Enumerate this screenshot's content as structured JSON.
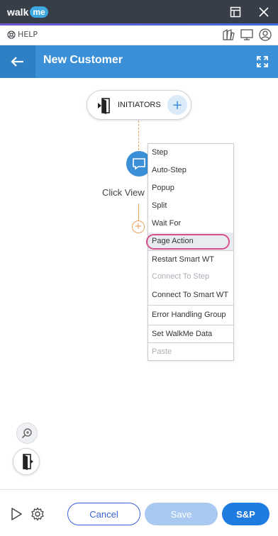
{
  "app": {
    "logo_walk": "walk",
    "logo_me": "me",
    "titlebar_icons": [
      "layout-icon",
      "close-icon"
    ]
  },
  "helpbar": {
    "help_label": "HELP",
    "icons": [
      "swatch-icon",
      "monitor-icon",
      "user-icon"
    ]
  },
  "header": {
    "title": "New Customer",
    "back_icon": "arrow-left-icon",
    "expand_icon": "expand-icon",
    "color": "#3a8fd6"
  },
  "canvas": {
    "initiators_label": "INITIATORS",
    "initiators_plus": "+",
    "node_label": "Click View",
    "add_step_plus": "+"
  },
  "menu": {
    "items": [
      {
        "label": "Step",
        "disabled": false
      },
      {
        "label": "Auto-Step",
        "disabled": false
      },
      {
        "label": "Popup",
        "disabled": false
      },
      {
        "label": "Split",
        "disabled": false
      },
      {
        "label": "Wait For",
        "disabled": false
      },
      {
        "label": "Page Action",
        "disabled": false,
        "highlighted": true
      },
      {
        "label": "Restart Smart WT",
        "disabled": false
      },
      {
        "label": "Connect To Step",
        "disabled": true
      },
      {
        "label": "Connect To Smart WT",
        "disabled": false
      },
      {
        "label": "Error Handling Group",
        "disabled": false
      },
      {
        "label": "Set WalkMe Data",
        "disabled": false
      },
      {
        "label": "Paste",
        "disabled": true
      }
    ]
  },
  "footer": {
    "cancel_label": "Cancel",
    "save_label": "Save",
    "sp_label": "S&P"
  },
  "colors": {
    "accent": "#3a8fd6",
    "highlight_ring": "#d9508f",
    "connector": "#e8a060"
  }
}
